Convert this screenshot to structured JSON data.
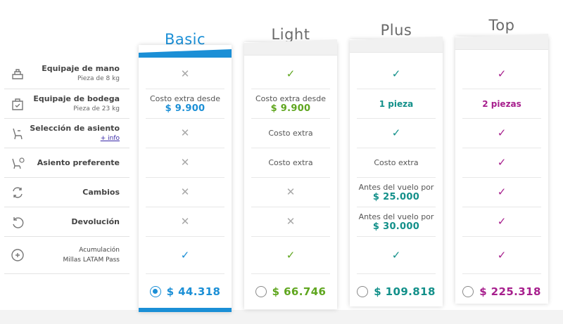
{
  "colors": {
    "basic": "#1b8fd6",
    "light": "#5fa61f",
    "plus": "#13908a",
    "top": "#a71f8d",
    "cross": "#a8a8a8"
  },
  "features": [
    {
      "label": "Equipaje de mano",
      "sub": "Pieza de 8 kg",
      "icon": "hand-luggage-icon"
    },
    {
      "label": "Equipaje de bodega",
      "sub": "Pieza de 23 kg",
      "icon": "checked-bag-icon"
    },
    {
      "label": "Selección de asiento",
      "link": "+ info",
      "icon": "seat-selection-icon"
    },
    {
      "label": "Asiento preferente",
      "icon": "preferred-seat-icon"
    },
    {
      "label": "Cambios",
      "icon": "changes-icon"
    },
    {
      "label": "Devolución",
      "icon": "refund-icon"
    },
    {
      "label": "Acumulación",
      "sub": "Millas LATAM Pass",
      "icon": "miles-icon"
    }
  ],
  "plans": [
    {
      "name": "Basic",
      "selected": true,
      "price": "$ 44.318",
      "cells": [
        {
          "type": "cross"
        },
        {
          "type": "text",
          "text": "Costo extra desde",
          "price": "$ 9.900"
        },
        {
          "type": "cross"
        },
        {
          "type": "cross"
        },
        {
          "type": "cross"
        },
        {
          "type": "cross"
        },
        {
          "type": "check"
        }
      ]
    },
    {
      "name": "Light",
      "selected": false,
      "price": "$ 66.746",
      "cells": [
        {
          "type": "check"
        },
        {
          "type": "text",
          "text": "Costo extra desde",
          "price": "$ 9.900"
        },
        {
          "type": "text",
          "text": "Costo extra"
        },
        {
          "type": "text",
          "text": "Costo extra"
        },
        {
          "type": "cross"
        },
        {
          "type": "cross"
        },
        {
          "type": "check"
        }
      ]
    },
    {
      "name": "Plus",
      "selected": false,
      "price": "$ 109.818",
      "cells": [
        {
          "type": "check"
        },
        {
          "type": "pieces",
          "text": "1 pieza"
        },
        {
          "type": "check"
        },
        {
          "type": "text",
          "text": "Costo extra"
        },
        {
          "type": "text",
          "text": "Antes del vuelo por",
          "price": "$ 25.000"
        },
        {
          "type": "text",
          "text": "Antes del vuelo por",
          "price": "$ 30.000"
        },
        {
          "type": "check"
        }
      ]
    },
    {
      "name": "Top",
      "selected": false,
      "price": "$ 225.318",
      "cells": [
        {
          "type": "check"
        },
        {
          "type": "pieces",
          "text": "2 piezas"
        },
        {
          "type": "check"
        },
        {
          "type": "check"
        },
        {
          "type": "check"
        },
        {
          "type": "check"
        },
        {
          "type": "check"
        }
      ]
    }
  ]
}
